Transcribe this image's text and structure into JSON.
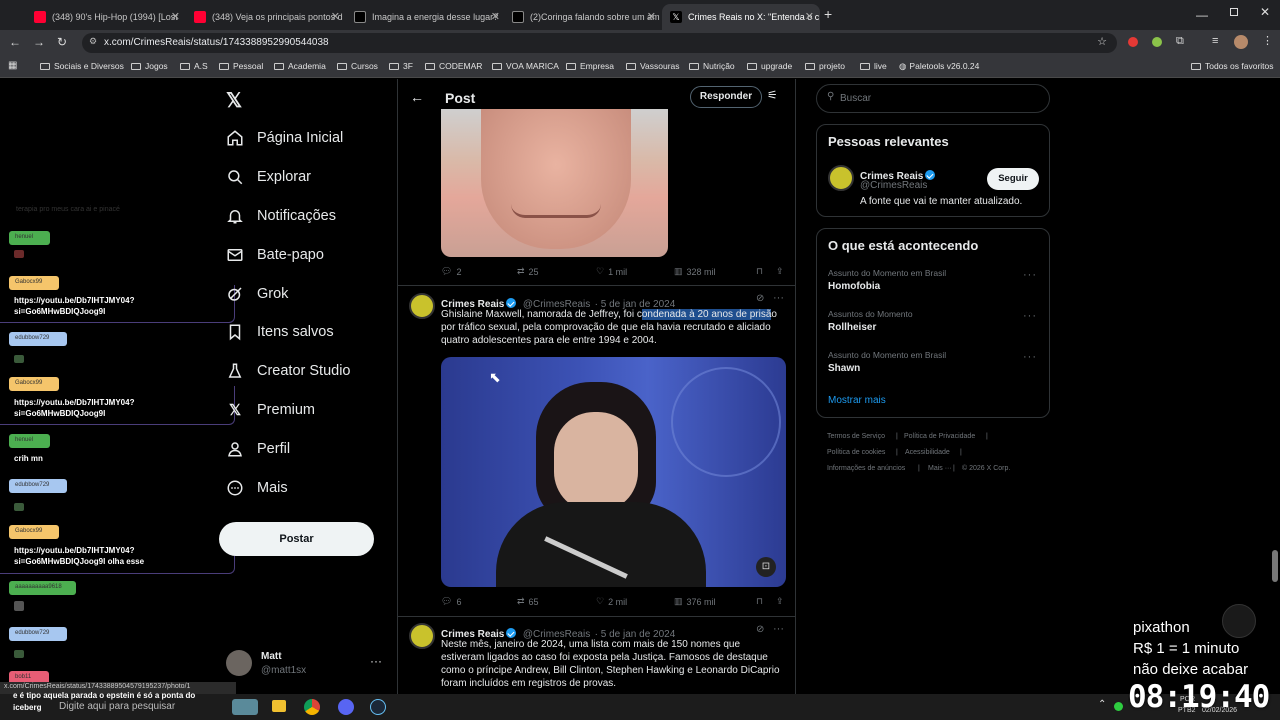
{
  "browser": {
    "tabs": [
      {
        "title": "(348) 90's Hip-Hop (1994) [Lost",
        "favicon_color": "#ff0033"
      },
      {
        "title": "(348) Veja os principais pontos d",
        "favicon_color": "#ff0033"
      },
      {
        "title": "Imagina a energia desse lugar?",
        "favicon_color": "#ffffff"
      },
      {
        "title": "(2)Coringa falando sobre um am",
        "favicon_color": "#ffffff"
      },
      {
        "title": "Crimes Reais no X: \"Entenda o c",
        "favicon_color": "#ffffff"
      }
    ],
    "new_tab_label": "+",
    "url": "x.com/CrimesReais/status/1743388952990544038",
    "bookmarks": [
      "Sociais e Diversos",
      "Jogos",
      "A.S",
      "Pessoal",
      "Academia",
      "Cursos",
      "3F",
      "CODEMAR",
      "VOA MARICA",
      "Empresa",
      "Vassouras",
      "Nutrição",
      "upgrade",
      "projeto",
      "live",
      "Paletools v26.0.24"
    ],
    "all_bookmarks_label": "Todos os favoritos",
    "status_url": "x.com/CrimesReais/status/1743388950457919523​7/photo/1"
  },
  "chat_overlay": {
    "faded_line": "terapia pro meus cara ai e pinacé",
    "messages": [
      {
        "user": "henuel",
        "user_color": "#4caf50",
        "text": ""
      },
      {
        "user": "Gabocx99",
        "user_color": "#f5c56b",
        "text_lines": [
          "https://youtu.be/Db7IHTJMY04?",
          "si=Go6MHwBDIQJoog9I"
        ]
      },
      {
        "user": "edubbow729",
        "user_color": "#a7c7f0",
        "text": ""
      },
      {
        "user": "Gabocx99",
        "user_color": "#f5c56b",
        "text_lines": [
          "https://youtu.be/Db7IHTJMY04?",
          "si=Go6MHwBDIQJoog9I"
        ]
      },
      {
        "user": "henuel",
        "user_color": "#4caf50",
        "text": "crih mn"
      },
      {
        "user": "edubbow729",
        "user_color": "#a7c7f0",
        "text": ""
      },
      {
        "user": "Gabocx99",
        "user_color": "#f5c56b",
        "text_lines": [
          "https://youtu.be/Db7IHTJMY04?",
          "si=Go6MHwBDIQJoog9I olha esse"
        ]
      },
      {
        "user": "aaaaaaaaaa9618",
        "user_color": "#4caf50",
        "text": ""
      },
      {
        "user": "edubbow729",
        "user_color": "#a7c7f0",
        "text": ""
      },
      {
        "user": "bob11",
        "user_color": "#e85d75",
        "text": ""
      }
    ],
    "bottom_lines": [
      "e é tipo aquela parada o epstein é só a ponta do",
      "iceberg"
    ]
  },
  "nav": {
    "items": [
      "Página Inicial",
      "Explorar",
      "Notificações",
      "Bate-papo",
      "Grok",
      "Itens salvos",
      "Creator Studio",
      "Premium",
      "Perfil",
      "Mais"
    ],
    "post_button": "Postar",
    "account_name": "Matt",
    "account_handle": "@matt1sx"
  },
  "post_header": {
    "title": "Post",
    "reply_button": "Responder"
  },
  "tweets": [
    {
      "stats": {
        "replies": "2",
        "retweets": "25",
        "likes": "1 mil",
        "views": "328 mil"
      }
    },
    {
      "name": "Crimes Reais",
      "handle": "@CrimesReais",
      "date": "· 5 de jan de 2024",
      "text_before": "Ghislaine Maxwell, namorada de Jeffrey, foi c",
      "text_highlight": "ondenada à 20 anos de prisã",
      "text_after": "o",
      "text_rest": "por tráfico sexual, pela comprovação de que ela havia recrutado e aliciado quatro adolescentes para ele entre 1994 e 2004.",
      "stats": {
        "replies": "6",
        "retweets": "65",
        "likes": "2 mil",
        "views": "376 mil"
      }
    },
    {
      "name": "Crimes Reais",
      "handle": "@CrimesReais",
      "date": "· 5 de jan de 2024",
      "text": "Neste mês, janeiro de 2024, uma lista com mais de 150 nomes que estiveram ligados ao caso foi exposta pela Justiça. Famosos de destaque como o príncipe Andrew, Bill Clinton, Stephen Hawking e Leonardo DiCaprio foram incluídos em registros de provas."
    }
  ],
  "sidebar": {
    "search_placeholder": "Buscar",
    "relevant_title": "Pessoas relevantes",
    "relevant_name": "Crimes Reais",
    "relevant_handle": "@CrimesReais",
    "relevant_bio": "A fonte que vai te manter atualizado.",
    "follow_button": "Seguir",
    "trends_title": "O que está acontecendo",
    "trends": [
      {
        "label": "Assunto do Momento em Brasil",
        "name": "Homofobia"
      },
      {
        "label": "Assuntos do Momento",
        "name": "Rollheiser"
      },
      {
        "label": "Assunto do Momento em Brasil",
        "name": "Shawn"
      }
    ],
    "show_more": "Mostrar mais",
    "footer": [
      "Termos de Serviço",
      "Política de Privacidade",
      "Política de cookies",
      "Acessibilidade",
      "Informações de anúncios",
      "Mais ···",
      "© 2026 X Corp."
    ]
  },
  "stream_overlay": {
    "line1": "pixathon",
    "line2": "R$ 1 = 1 minuto",
    "line3": "não deixe acabar",
    "timer": "08:19:40"
  },
  "taskbar": {
    "search_placeholder": "Digite aqui para pesquisar",
    "lang": "POR",
    "lang2": "PTB2",
    "date": "02/02/2026"
  },
  "colors": {
    "accent": "#1d9bf0",
    "highlight": "#1f4f8f"
  }
}
